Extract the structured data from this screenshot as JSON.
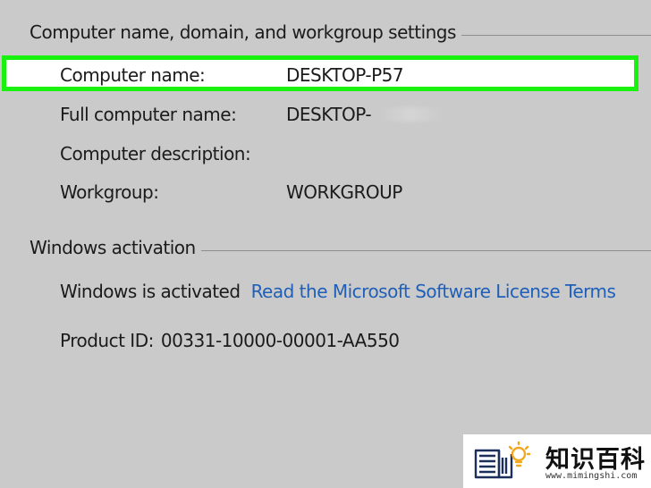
{
  "computer_section": {
    "title": "Computer name, domain, and workgroup settings",
    "rows": [
      {
        "label": "Computer name:",
        "value": "DESKTOP-P57"
      },
      {
        "label": "Full computer name:",
        "value": "DESKTOP-"
      },
      {
        "label": "Computer description:",
        "value": ""
      },
      {
        "label": "Workgroup:",
        "value": "WORKGROUP"
      }
    ],
    "highlight_color": "#19f20e"
  },
  "activation_section": {
    "title": "Windows activation",
    "status": "Windows is activated",
    "license_link": "Read the Microsoft Software License Terms",
    "product_id_label": "Product ID:",
    "product_id": "00331-10000-00001-AA550",
    "link_color": "#1f5fb8"
  },
  "watermark": {
    "title": "知识百科",
    "url": "www.mimingshi.com",
    "icon": "book-lightbulb-icon"
  }
}
